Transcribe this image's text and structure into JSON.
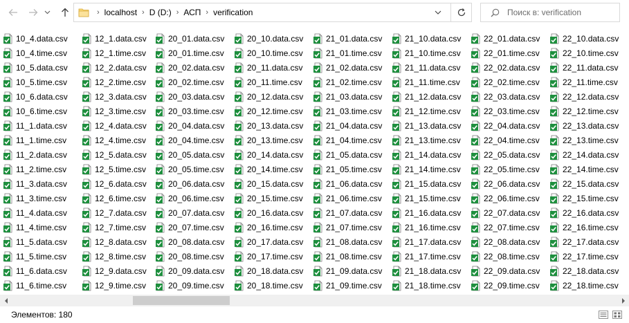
{
  "nav": {
    "back_icon": "arrow-left-icon",
    "forward_icon": "arrow-right-icon",
    "recent_icon": "chevron-down-icon",
    "up_icon": "arrow-up-icon",
    "refresh_icon": "refresh-icon"
  },
  "address": {
    "crumbs": [
      "localhost",
      "D (D:)",
      "АСП",
      "verification"
    ]
  },
  "search": {
    "placeholder": "Поиск в: verification"
  },
  "files": {
    "columns": [
      [
        "10_4.data.csv",
        "10_4.time.csv",
        "10_5.data.csv",
        "10_5.time.csv",
        "10_6.data.csv",
        "10_6.time.csv",
        "11_1.data.csv",
        "11_1.time.csv",
        "11_2.data.csv",
        "11_2.time.csv",
        "11_3.data.csv",
        "11_3.time.csv",
        "11_4.data.csv",
        "11_4.time.csv",
        "11_5.data.csv",
        "11_5.time.csv",
        "11_6.data.csv",
        "11_6.time.csv"
      ],
      [
        "12_1.data.csv",
        "12_1.time.csv",
        "12_2.data.csv",
        "12_2.time.csv",
        "12_3.data.csv",
        "12_3.time.csv",
        "12_4.data.csv",
        "12_4.time.csv",
        "12_5.data.csv",
        "12_5.time.csv",
        "12_6.data.csv",
        "12_6.time.csv",
        "12_7.data.csv",
        "12_7.time.csv",
        "12_8.data.csv",
        "12_8.time.csv",
        "12_9.data.csv",
        "12_9.time.csv"
      ],
      [
        "20_01.data.csv",
        "20_01.time.csv",
        "20_02.data.csv",
        "20_02.time.csv",
        "20_03.data.csv",
        "20_03.time.csv",
        "20_04.data.csv",
        "20_04.time.csv",
        "20_05.data.csv",
        "20_05.time.csv",
        "20_06.data.csv",
        "20_06.time.csv",
        "20_07.data.csv",
        "20_07.time.csv",
        "20_08.data.csv",
        "20_08.time.csv",
        "20_09.data.csv",
        "20_09.time.csv"
      ],
      [
        "20_10.data.csv",
        "20_10.time.csv",
        "20_11.data.csv",
        "20_11.time.csv",
        "20_12.data.csv",
        "20_12.time.csv",
        "20_13.data.csv",
        "20_13.time.csv",
        "20_14.data.csv",
        "20_14.time.csv",
        "20_15.data.csv",
        "20_15.time.csv",
        "20_16.data.csv",
        "20_16.time.csv",
        "20_17.data.csv",
        "20_17.time.csv",
        "20_18.data.csv",
        "20_18.time.csv"
      ],
      [
        "21_01.data.csv",
        "21_01.time.csv",
        "21_02.data.csv",
        "21_02.time.csv",
        "21_03.data.csv",
        "21_03.time.csv",
        "21_04.data.csv",
        "21_04.time.csv",
        "21_05.data.csv",
        "21_05.time.csv",
        "21_06.data.csv",
        "21_06.time.csv",
        "21_07.data.csv",
        "21_07.time.csv",
        "21_08.data.csv",
        "21_08.time.csv",
        "21_09.data.csv",
        "21_09.time.csv"
      ],
      [
        "21_10.data.csv",
        "21_10.time.csv",
        "21_11.data.csv",
        "21_11.time.csv",
        "21_12.data.csv",
        "21_12.time.csv",
        "21_13.data.csv",
        "21_13.time.csv",
        "21_14.data.csv",
        "21_14.time.csv",
        "21_15.data.csv",
        "21_15.time.csv",
        "21_16.data.csv",
        "21_16.time.csv",
        "21_17.data.csv",
        "21_17.time.csv",
        "21_18.data.csv",
        "21_18.time.csv"
      ],
      [
        "22_01.data.csv",
        "22_01.time.csv",
        "22_02.data.csv",
        "22_02.time.csv",
        "22_03.data.csv",
        "22_03.time.csv",
        "22_04.data.csv",
        "22_04.time.csv",
        "22_05.data.csv",
        "22_05.time.csv",
        "22_06.data.csv",
        "22_06.time.csv",
        "22_07.data.csv",
        "22_07.time.csv",
        "22_08.data.csv",
        "22_08.time.csv",
        "22_09.data.csv",
        "22_09.time.csv"
      ],
      [
        "22_10.data.csv",
        "22_10.time.csv",
        "22_11.data.csv",
        "22_11.time.csv",
        "22_12.data.csv",
        "22_12.time.csv",
        "22_13.data.csv",
        "22_13.time.csv",
        "22_14.data.csv",
        "22_14.time.csv",
        "22_15.data.csv",
        "22_15.time.csv",
        "22_16.data.csv",
        "22_16.time.csv",
        "22_17.data.csv",
        "22_17.time.csv",
        "22_18.data.csv",
        "22_18.time.csv"
      ]
    ],
    "file_icon": "csv-file-icon"
  },
  "status": {
    "item_count": "Элементов: 180",
    "details_view_icon": "details-view-icon",
    "large_icons_view_icon": "large-icons-view-icon"
  },
  "colors": {
    "file_icon_green": "#1e8f3e",
    "border": "#d9d9d9",
    "scrollbar_bg": "#f0f0f0",
    "scrollbar_thumb": "#cdcdcd"
  }
}
